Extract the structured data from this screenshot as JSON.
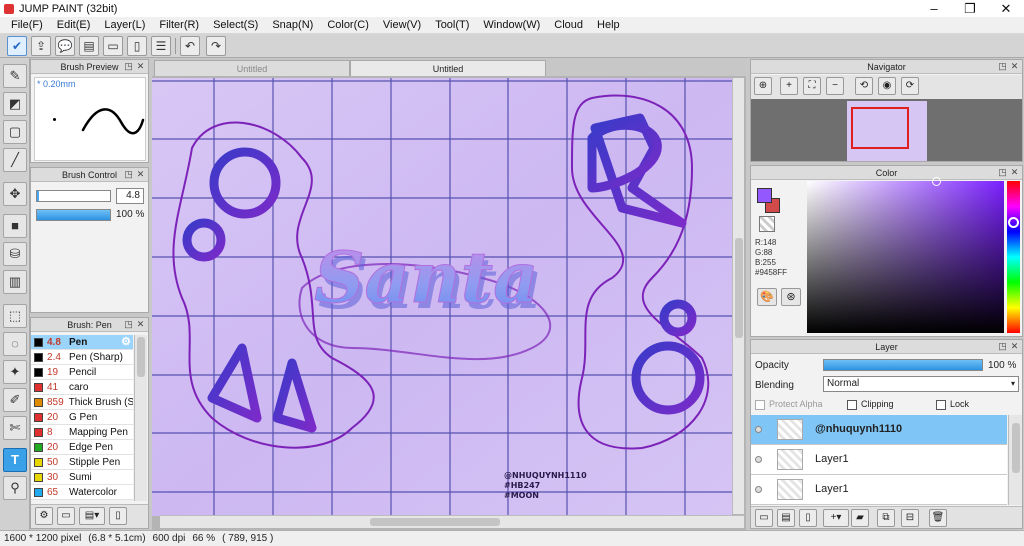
{
  "app": {
    "title": "JUMP PAINT (32bit)",
    "window_controls": [
      "–",
      "❐",
      "✕"
    ]
  },
  "menu": [
    "File(F)",
    "Edit(E)",
    "Layer(L)",
    "Filter(R)",
    "Select(S)",
    "Snap(N)",
    "Color(C)",
    "View(V)",
    "Tool(T)",
    "Window(W)",
    "Cloud",
    "Help"
  ],
  "toolbar": {
    "icons": [
      "check-circle-icon",
      "share-icon",
      "speech-icon",
      "comment-icon",
      "page-icon",
      "page2-icon",
      "list-icon",
      "grid-icon",
      "undo-icon",
      "redo-icon"
    ],
    "glyphs": [
      "✔",
      "⇪",
      "💬",
      "▤",
      "▭",
      "▯",
      "☰",
      "▦",
      "↶",
      "↷"
    ]
  },
  "tools": [
    {
      "name": "pen-tool",
      "glyph": "✎"
    },
    {
      "name": "eraser-tool",
      "glyph": "◩"
    },
    {
      "name": "rect-select-tool",
      "glyph": "▢"
    },
    {
      "name": "line-tool",
      "glyph": "╱"
    },
    {
      "name": "move-tool",
      "glyph": "✥"
    },
    {
      "name": "fill-rect-tool",
      "glyph": "■"
    },
    {
      "name": "bucket-tool",
      "glyph": "⛁"
    },
    {
      "name": "gradient-tool",
      "glyph": "▥"
    },
    {
      "name": "select-rect-tool",
      "glyph": "⬚"
    },
    {
      "name": "lasso-tool",
      "glyph": "◌"
    },
    {
      "name": "magic-wand-tool",
      "glyph": "✦"
    },
    {
      "name": "select-pen-tool",
      "glyph": "✐"
    },
    {
      "name": "select-eraser-tool",
      "glyph": "✄"
    },
    {
      "name": "text-tool",
      "glyph": "T"
    },
    {
      "name": "eyedropper-tool",
      "glyph": "⚲"
    }
  ],
  "brush_preview": {
    "title": "Brush Preview",
    "size_label": "* 0.20mm"
  },
  "brush_control": {
    "title": "Brush Control",
    "size_value": "4.8",
    "opacity_value": "100 %",
    "opacity": 1.0
  },
  "brush_list": {
    "title": "Brush: Pen",
    "items": [
      {
        "size": "4.8",
        "name": "Pen",
        "color": "#000000",
        "selected": true
      },
      {
        "size": "2.4",
        "name": "Pen (Sharp)",
        "color": "#000000",
        "selected": false
      },
      {
        "size": "19",
        "name": "Pencil",
        "color": "#000000",
        "selected": false
      },
      {
        "size": "41",
        "name": "caro",
        "color": "#e03030",
        "selected": false
      },
      {
        "size": "859",
        "name": "Thick Brush (S",
        "color": "#e08a00",
        "selected": false
      },
      {
        "size": "20",
        "name": "G Pen",
        "color": "#e03030",
        "selected": false
      },
      {
        "size": "8",
        "name": "Mapping Pen",
        "color": "#e03030",
        "selected": false
      },
      {
        "size": "20",
        "name": "Edge Pen",
        "color": "#22aa22",
        "selected": false
      },
      {
        "size": "50",
        "name": "Stipple Pen",
        "color": "#e8d600",
        "selected": false
      },
      {
        "size": "30",
        "name": "Sumi",
        "color": "#e8d600",
        "selected": false
      },
      {
        "size": "65",
        "name": "Watercolor",
        "color": "#22aaee",
        "selected": false
      }
    ]
  },
  "doc_tabs": [
    {
      "label": "Untitled",
      "active": false
    },
    {
      "label": "Untitled",
      "active": true
    }
  ],
  "canvas": {
    "artwork_text": "Santa",
    "signature_lines": [
      "@NHUQUYNH1110",
      "#HB247",
      "#MOON"
    ]
  },
  "navigator": {
    "title": "Navigator"
  },
  "color_panel": {
    "title": "Color",
    "r": "R:148",
    "g": "G:88",
    "b": "B:255",
    "hex": "#9458FF",
    "main_color": "#9458ff",
    "sub_color": "#d24a4a"
  },
  "layer_panel": {
    "title": "Layer",
    "opacity_label": "Opacity",
    "opacity_value": "100 %",
    "opacity": 1.0,
    "blending_label": "Blending",
    "blending_value": "Normal",
    "protect_alpha": "Protect Alpha",
    "clipping": "Clipping",
    "lock": "Lock",
    "layers": [
      {
        "name": "@nhuquynh1110",
        "selected": true
      },
      {
        "name": "Layer1",
        "selected": false
      },
      {
        "name": "Layer1",
        "selected": false
      }
    ]
  },
  "status": {
    "size": "1600 * 1200 pixel",
    "phys": "(6.8 * 5.1cm)",
    "dpi": "600 dpi",
    "zoom": "66 %",
    "coords": "( 789, 915 )"
  }
}
